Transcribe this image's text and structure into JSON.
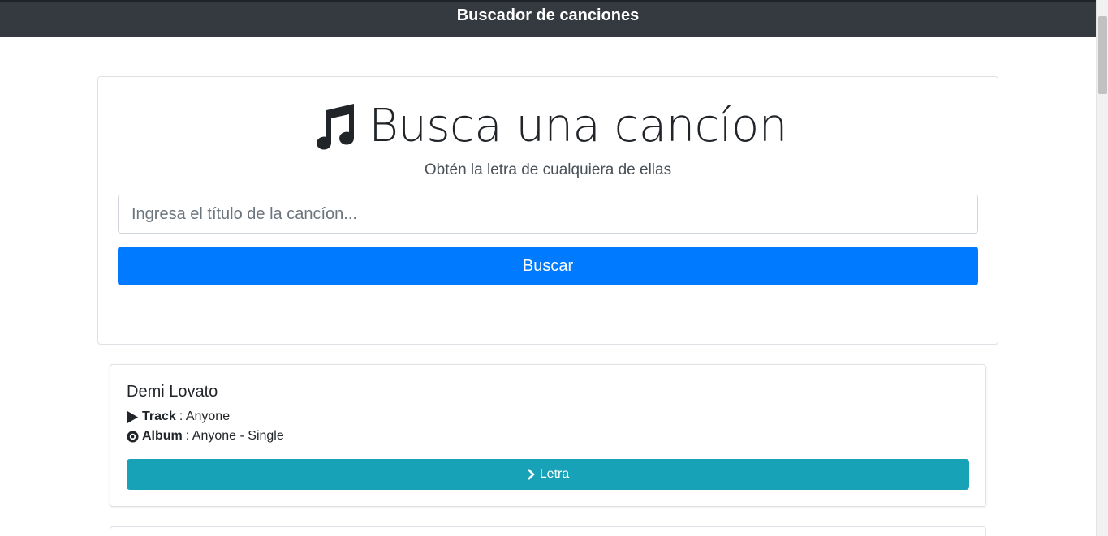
{
  "navbar": {
    "title": "Buscador de canciones"
  },
  "search": {
    "heading": "Busca una cancíon",
    "subtitle": "Obtén la letra de cualquiera de ellas",
    "placeholder": "Ingresa el título de la cancíon...",
    "value": "",
    "button_label": "Buscar"
  },
  "results": [
    {
      "artist": "Demi Lovato",
      "track_label": "Track",
      "track": ": Anyone",
      "album_label": "Album",
      "album": ": Anyone - Single",
      "lyrics_button": "Letra"
    }
  ],
  "icons": {
    "heading": "music-note-icon",
    "track": "play-icon",
    "album": "compact-disc-icon",
    "lyrics": "chevron-right-icon"
  },
  "colors": {
    "navbar": "#343a40",
    "primary": "#007bff",
    "info": "#17a2b8",
    "text": "#212529"
  }
}
